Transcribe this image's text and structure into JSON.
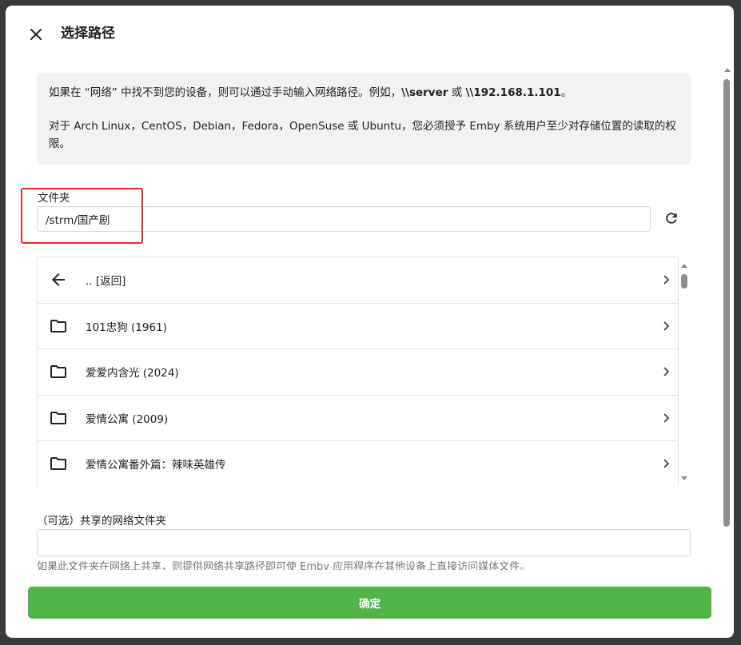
{
  "dialog": {
    "title": "选择路径",
    "close_icon": "close-icon"
  },
  "info": {
    "line1_prefix": "如果在 “网络” 中找不到您的设备，则可以通过手动输入网络路径。例如，",
    "example1": "\\\\server",
    "line1_or": " 或 ",
    "example2": "\\\\192.168.1.101",
    "line1_suffix": "。",
    "line2": "对于 Arch Linux，CentOS，Debian，Fedora，OpenSuse 或 Ubuntu，您必须授予 Emby 系统用户至少对存储位置的读取的权限。"
  },
  "folder": {
    "label": "文件夹",
    "value": "/strm/国产剧",
    "refresh_icon": "refresh-icon"
  },
  "list": {
    "items": [
      {
        "label": ".. [返回]",
        "icon": "arrow-left-icon"
      },
      {
        "label": "101忠狗 (1961)",
        "icon": "folder-icon"
      },
      {
        "label": "爱爱内含光 (2024)",
        "icon": "folder-icon"
      },
      {
        "label": "爱情公寓 (2009)",
        "icon": "folder-icon"
      },
      {
        "label": "爱情公寓番外篇：辣味英雄传",
        "icon": "folder-icon"
      }
    ]
  },
  "share": {
    "label": "（可选）共享的网络文件夹",
    "value": "",
    "help": "如果此文件夹在网络上共享，则提供网络共享路径即可使 Emby 应用程序在其他设备上直接访问媒体文件。"
  },
  "confirm": {
    "label": "确定"
  },
  "colors": {
    "accent": "#52b54b",
    "highlight": "#e52b2b",
    "info_bg": "#f2f2f2"
  }
}
